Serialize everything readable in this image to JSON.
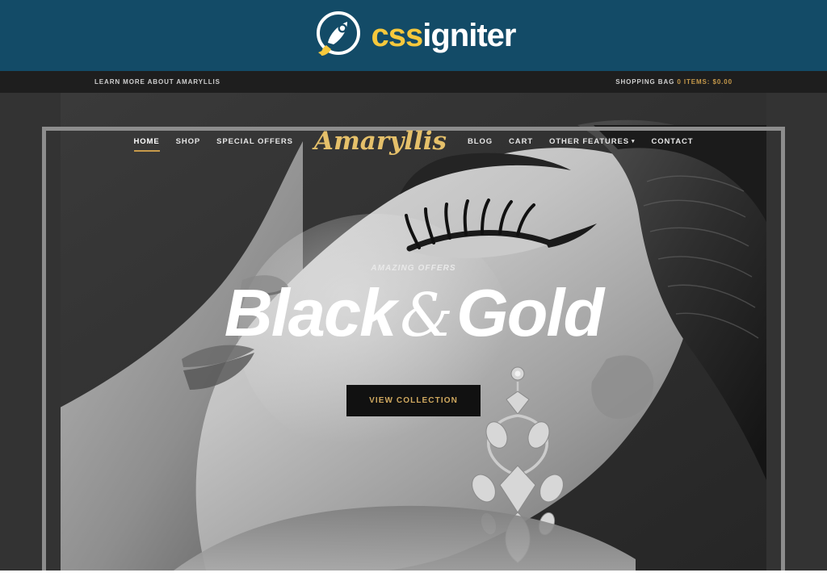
{
  "brandbar": {
    "logo_icon": "rocket-circle-icon",
    "wordmark_prefix": "css",
    "wordmark_suffix": "igniter",
    "bg_color": "#134b67",
    "accent_color": "#f6c83c"
  },
  "topbar": {
    "left_link": "LEARN MORE ABOUT AMARYLLIS",
    "cart_label": "SHOPPING BAG",
    "cart_amount": "0 ITEMS: $0.00",
    "bg_color": "#1e1e1e",
    "gold_color": "#c79a4b"
  },
  "nav": {
    "left_items": [
      {
        "label": "HOME",
        "active": true
      },
      {
        "label": "SHOP",
        "active": false
      },
      {
        "label": "SPECIAL OFFERS",
        "active": false
      }
    ],
    "brand": "Amaryllis",
    "right_items": [
      {
        "label": "BLOG",
        "has_caret": false
      },
      {
        "label": "CART",
        "has_caret": false
      },
      {
        "label": "OTHER FEATURES",
        "has_caret": true
      },
      {
        "label": "CONTACT",
        "has_caret": false
      }
    ],
    "caret_glyph": "▾",
    "brand_color": "#e5c06a",
    "active_underline_color": "#c79a4b"
  },
  "hero": {
    "subtitle": "AMAZING OFFERS",
    "title_part1": "Black",
    "title_amp": "&",
    "title_part2": "Gold",
    "button_label": "VIEW COLLECTION",
    "button_bg": "#111111",
    "button_text_color": "#cfa85f",
    "image_alt": "black-and-white portrait of a woman wearing a chandelier earring",
    "background_color": "#333333",
    "frame_color": "#8d8d8d"
  }
}
